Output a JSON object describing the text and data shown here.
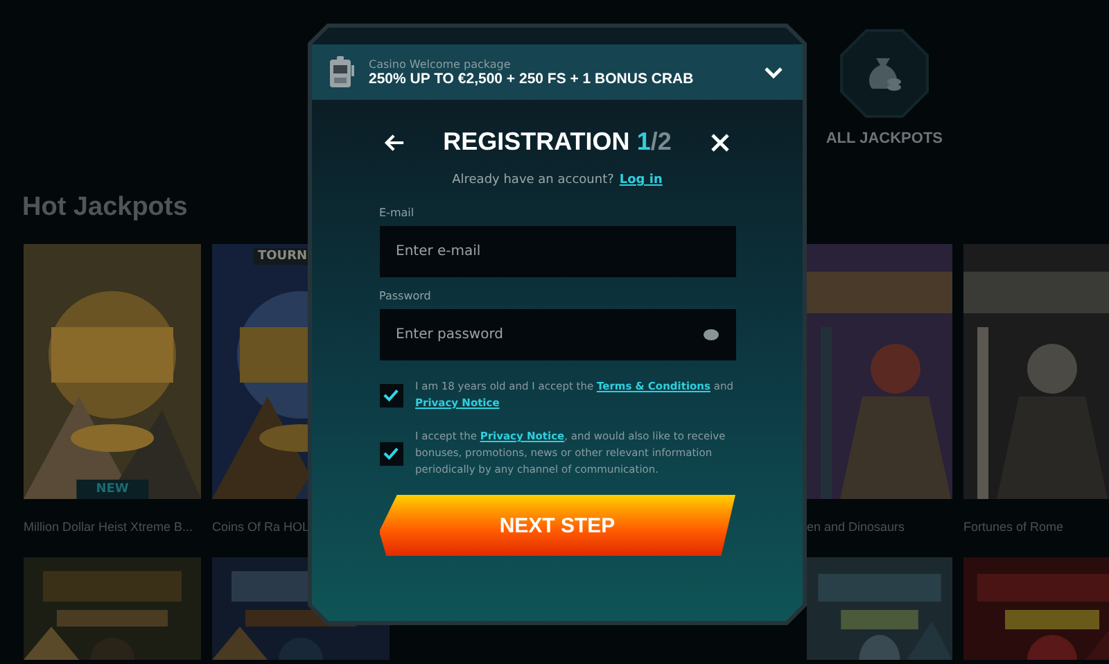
{
  "page": {
    "heading": "Hot Jackpots",
    "jackpots_link": "ALL JACKPOTS",
    "games_left": [
      {
        "title": "Million Dollar Heist Xtreme B...",
        "badge": {
          "text": "NEW",
          "kind": "new"
        }
      },
      {
        "title": "Coins Of Ra HOL",
        "badge": {
          "text": "TOURN",
          "kind": "tournament"
        }
      }
    ],
    "games_right": [
      {
        "title": "en and Dinosaurs"
      },
      {
        "title": "Fortunes of Rome"
      }
    ]
  },
  "promo": {
    "label": "Casino Welcome package",
    "offer": "250% UP TO €2,500 + 250 FS + 1 BONUS CRAB",
    "expanded": false
  },
  "dialog": {
    "title": "REGISTRATION",
    "step": "1",
    "step_total": "/2",
    "login_prompt": "Already have an account?",
    "login_link": "Log in"
  },
  "fields": [
    {
      "label": "E-mail",
      "placeholder": "Enter e-mail",
      "kind": "email"
    },
    {
      "label": "Password",
      "placeholder": "Enter password",
      "kind": "password"
    }
  ],
  "consents": [
    {
      "checked": true,
      "parts": [
        {
          "kind": "text",
          "text": "I am 18 years old and I accept the "
        },
        {
          "kind": "link",
          "text": "Terms & Conditions"
        },
        {
          "kind": "text",
          "text": " and "
        },
        {
          "kind": "link",
          "text": "Privacy Notice"
        }
      ]
    },
    {
      "checked": true,
      "parts": [
        {
          "kind": "text",
          "text": "I accept the "
        },
        {
          "kind": "link",
          "text": "Privacy Notice"
        },
        {
          "kind": "text",
          "text": ", and would also like to receive bonuses, promotions, news or other relevant information periodically by any channel of communication."
        }
      ]
    }
  ],
  "submit": "NEXT STEP"
}
